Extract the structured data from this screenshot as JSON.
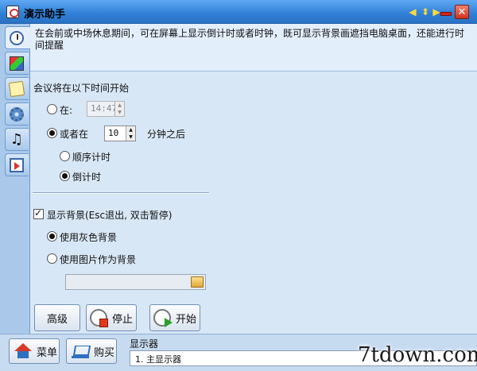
{
  "window": {
    "title": "演示助手"
  },
  "sidebar": {
    "tabs": [
      {
        "icon": "stopwatch-icon",
        "active": true
      },
      {
        "icon": "paint-icon",
        "active": false
      },
      {
        "icon": "note-icon",
        "active": false
      },
      {
        "icon": "gear-icon",
        "active": false
      },
      {
        "icon": "music-icon",
        "active": false
      },
      {
        "icon": "screen-icon",
        "active": false
      }
    ]
  },
  "main": {
    "description": "在会前或中场休息期间，可在屏幕上显示倒计时或者时钟，既可显示背景画遮挡电脑桌面，还能进行时间提醒",
    "start_heading": "会议将在以下时间开始",
    "at_label": "在:",
    "at_time": "14:47",
    "or_label": "或者在",
    "minutes_value": "10",
    "minutes_suffix": "分钟之后",
    "count_up_label": "顺序计时",
    "count_down_label": "倒计时",
    "show_bg_label": "显示背景(Esc退出, 双击暂停)",
    "gray_bg_label": "使用灰色背景",
    "image_bg_label": "使用图片作为背景",
    "image_path": ""
  },
  "buttons": {
    "advanced": "高级",
    "stop": "停止",
    "start": "开始"
  },
  "bottom": {
    "menu": "菜单",
    "buy": "购买",
    "display_label": "显示器",
    "display_value": "1. 主显示器"
  },
  "watermark": "7tdown.com",
  "colors": {
    "titlebar": "#2f7fd6",
    "panel": "#d8e7f6",
    "close": "#d0321c"
  }
}
